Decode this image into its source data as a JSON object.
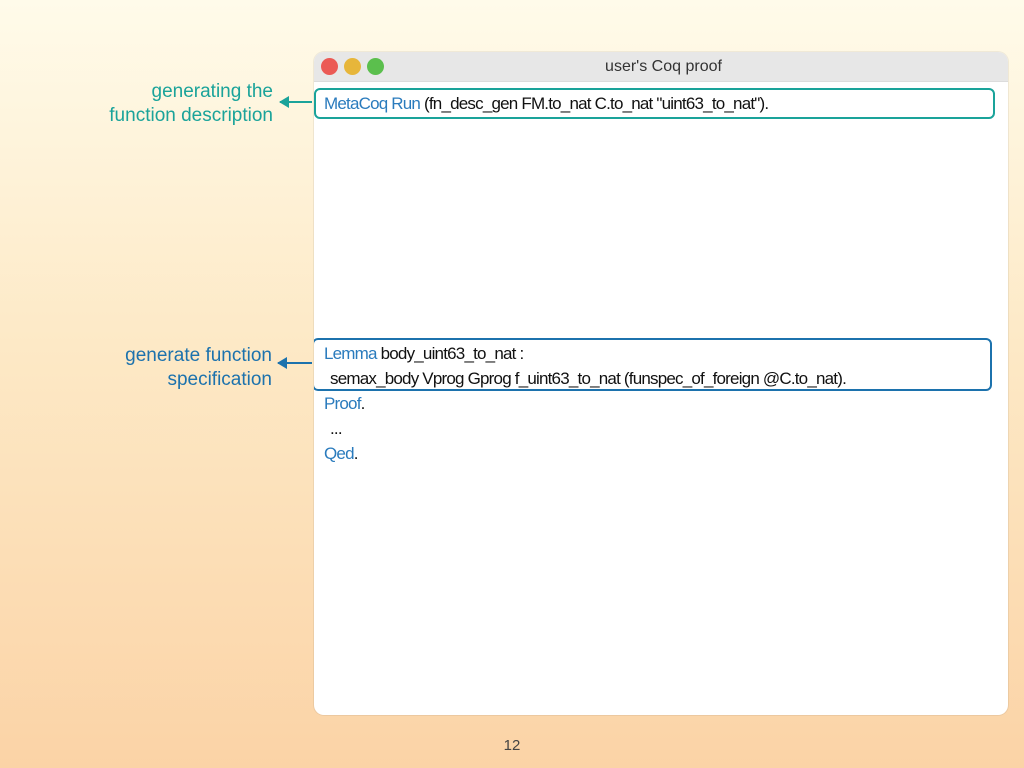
{
  "annotations": {
    "top": [
      "generating the",
      "function description"
    ],
    "bottom": [
      "generate function",
      "specification"
    ]
  },
  "window": {
    "title": "user's Coq proof"
  },
  "code": {
    "run_kw": "MetaCoq Run",
    "run_rest": " (fn_desc_gen FM.to_nat C.to_nat \"uint63_to_nat\").",
    "lemma_kw": "Lemma",
    "lemma_rest": " body_uint63_to_nat :",
    "body": "semax_body Vprog Gprog f_uint63_to_nat (funspec_of_foreign @C.to_nat).",
    "proof_kw": "Proof",
    "proof_rest": ".",
    "dots": "...",
    "qed_kw": "Qed",
    "qed_rest": "."
  },
  "colors": {
    "keyword": "#2a7bbd",
    "highlight_top": "#1aa39a",
    "highlight_bottom": "#1c72ad"
  },
  "page_number": "12"
}
